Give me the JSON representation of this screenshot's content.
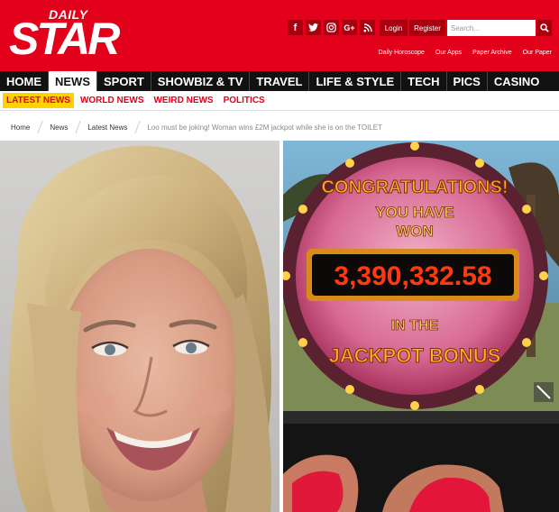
{
  "header": {
    "logo_daily": "DAILY",
    "logo_star": "STAR",
    "social_icons": [
      "facebook-icon",
      "twitter-icon",
      "instagram-icon",
      "google-plus-icon",
      "rss-icon"
    ],
    "login_label": "Login",
    "register_label": "Register",
    "search_placeholder": "Search...",
    "top_links": [
      "Daily Horoscope",
      "Our Apps",
      "Paper Archive",
      "Our Paper"
    ],
    "brand_color": "#e2001a"
  },
  "main_nav": [
    "HOME",
    "NEWS",
    "SPORT",
    "SHOWBIZ & TV",
    "TRAVEL",
    "LIFE & STYLE",
    "TECH",
    "PICS",
    "CASINO"
  ],
  "main_nav_active": "NEWS",
  "sub_nav": [
    "LATEST NEWS",
    "WORLD NEWS",
    "WEIRD NEWS",
    "POLITICS"
  ],
  "sub_nav_active": "LATEST NEWS",
  "breadcrumb": [
    "Home",
    "News",
    "Latest News",
    "Loo must be joking! Woman wins £2M jackpot while she is on the TOILET"
  ],
  "jackpot": {
    "line1": "CONGRATULATIONS!",
    "line2": "YOU HAVE",
    "line3": "WON",
    "amount": "3,390,332.58",
    "line4": "IN THE",
    "line5": "JACKPOT BONUS"
  }
}
